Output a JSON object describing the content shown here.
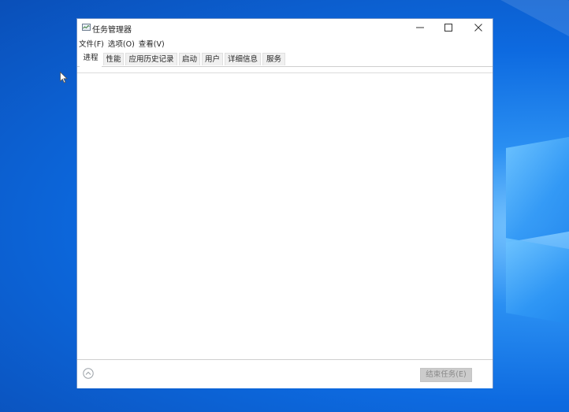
{
  "window": {
    "title": "任务管理器",
    "controls": {
      "minimize": "—",
      "maximize": "☐",
      "close": "✕"
    }
  },
  "menubar": [
    {
      "label": "文件(F)"
    },
    {
      "label": "选项(O)"
    },
    {
      "label": "查看(V)"
    }
  ],
  "tabs": [
    {
      "label": "进程",
      "active": true
    },
    {
      "label": "性能"
    },
    {
      "label": "应用历史记录"
    },
    {
      "label": "启动"
    },
    {
      "label": "用户"
    },
    {
      "label": "详细信息"
    },
    {
      "label": "服务"
    }
  ],
  "footer": {
    "end_task_label": "结束任务(E)",
    "end_task_enabled": false
  },
  "colors": {
    "desktop_accent": "#0d6ae0",
    "window_border": "#6b8fc7",
    "disabled_button": "#cccccc"
  },
  "icons": {
    "app": "task-manager-icon",
    "expand": "chevron-up-circle-icon",
    "cursor": "mouse-pointer-icon"
  }
}
